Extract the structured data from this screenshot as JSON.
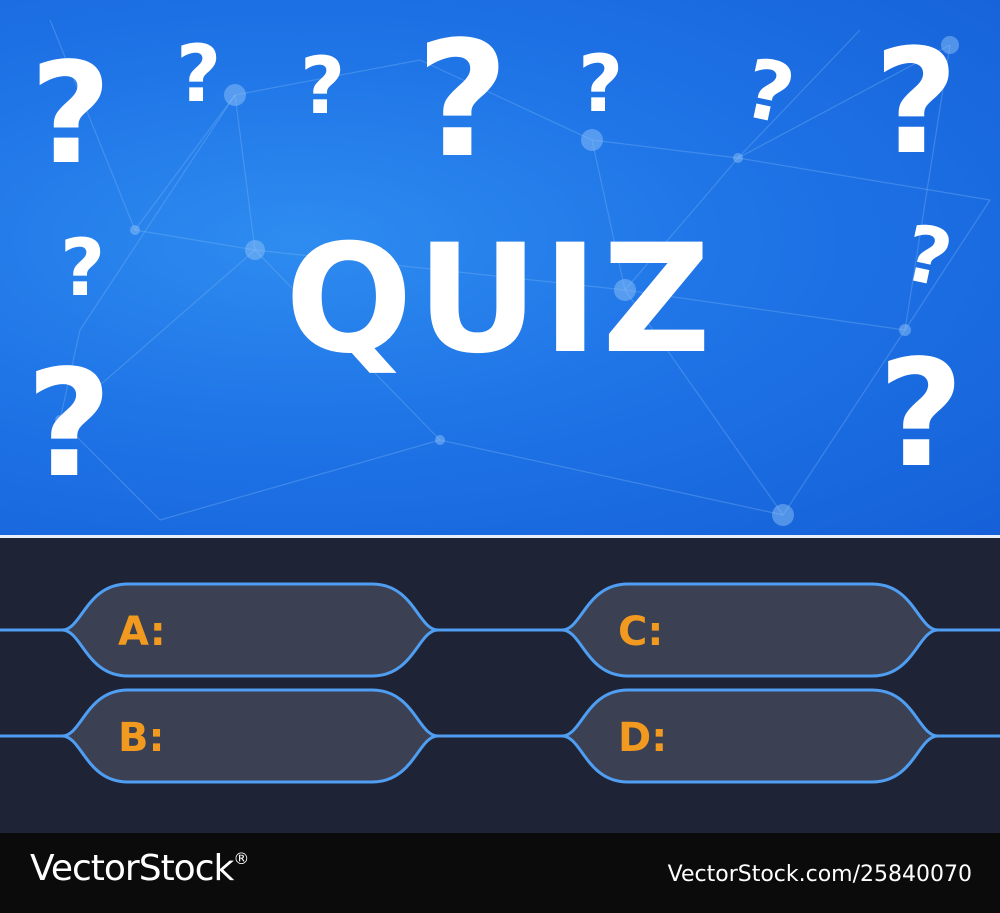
{
  "header": {
    "title": "QUIZ"
  },
  "decoration": {
    "glyph": "?",
    "icon": "question-mark-icon"
  },
  "answers": [
    {
      "letter": "A:",
      "text": ""
    },
    {
      "letter": "B:",
      "text": ""
    },
    {
      "letter": "C:",
      "text": ""
    },
    {
      "letter": "D:",
      "text": ""
    }
  ],
  "footer": {
    "brand": "VectorStock",
    "trademark": "®",
    "stock_id": "VectorStock.com/25840070"
  },
  "colors": {
    "sky": "#1f74e6",
    "panel": "#1e2336",
    "answer_box": "#3b4052",
    "outline": "#4f9ef2",
    "letter": "#f29a1f"
  }
}
